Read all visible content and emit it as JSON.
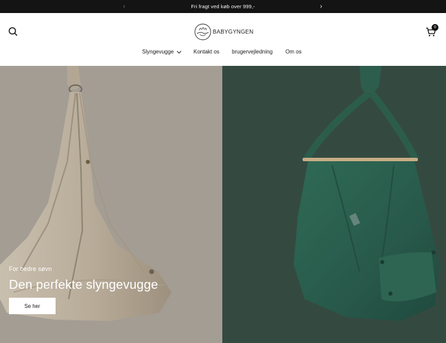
{
  "announcement": {
    "text": "Fri fragt ved køb over 999,-",
    "prev_icon": "chevron-left-icon",
    "next_icon": "chevron-right-icon"
  },
  "header": {
    "logo_text": "BABYGYNGEN",
    "search_icon": "search-icon",
    "cart_icon": "cart-icon",
    "cart_count": "0"
  },
  "nav": {
    "items": [
      {
        "label": "Slyngevugge",
        "has_dropdown": true
      },
      {
        "label": "Kontakt os"
      },
      {
        "label": "brugervejledning"
      },
      {
        "label": "Om os"
      }
    ]
  },
  "hero": {
    "subtitle": "For bedre søvn",
    "title": "Den perfekte slyngevugge",
    "button_label": "Se her"
  },
  "colors": {
    "announcement_bg": "#141414",
    "left_panel_bg": "#a39d94",
    "right_panel_bg": "#344a41"
  }
}
